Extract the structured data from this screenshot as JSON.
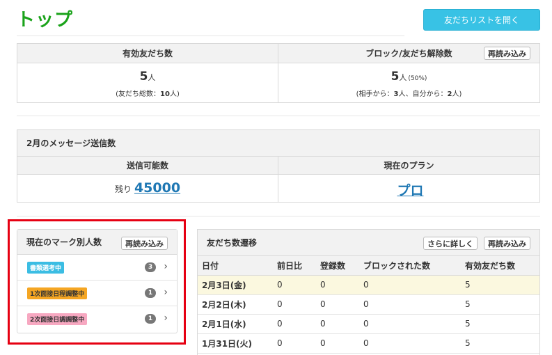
{
  "page": {
    "title": "トップ"
  },
  "header": {
    "open_friends_list_label": "友だちリストを開く"
  },
  "stats": {
    "active": {
      "heading": "有効友だち数",
      "value": "5",
      "unit": "人",
      "sub_prefix": "(友だち総数：",
      "sub_total": "10",
      "sub_suffix": "人)"
    },
    "blocked": {
      "heading": "ブロック/友だち解除数",
      "reload_label": "再読み込み",
      "value": "5",
      "unit": "人",
      "pct": "(50%)",
      "sub_a": "(相手から：",
      "sub_a_val": "3",
      "sub_b": "人、自分から：",
      "sub_b_val": "2",
      "sub_c": "人)"
    }
  },
  "messages": {
    "title": "2月のメッセージ送信数",
    "sendable": {
      "heading": "送信可能数",
      "prefix": "残り",
      "value": "45000"
    },
    "plan": {
      "heading": "現在のプラン",
      "value": "プロ"
    }
  },
  "marks": {
    "title": "現在のマーク別人数",
    "reload_label": "再読み込み",
    "items": [
      {
        "label": "書類選考中",
        "count": "3",
        "color": "#3bbde3"
      },
      {
        "label": "1次面接日程調整中",
        "count": "1",
        "color": "#f5a623"
      },
      {
        "label": "2次面接日調調整中",
        "count": "1",
        "color": "#f7a8c1"
      }
    ]
  },
  "trend": {
    "title": "友だち数遷移",
    "more_label": "さらに詳しく",
    "reload_label": "再読み込み",
    "columns": [
      "日付",
      "前日比",
      "登録数",
      "ブロックされた数",
      "有効友だち数"
    ],
    "rows": [
      [
        "2月3日(金)",
        "0",
        "0",
        "0",
        "5"
      ],
      [
        "2月2日(木)",
        "0",
        "0",
        "0",
        "5"
      ],
      [
        "2月1日(水)",
        "0",
        "0",
        "0",
        "5"
      ],
      [
        "1月31日(火)",
        "0",
        "0",
        "0",
        "5"
      ]
    ]
  },
  "colors": {
    "title_green": "#1aa31a",
    "primary_button": "#38c2e5",
    "link_blue": "#1f78b4",
    "highlight_red": "#e60012",
    "row_highlight": "#fbf8df"
  }
}
